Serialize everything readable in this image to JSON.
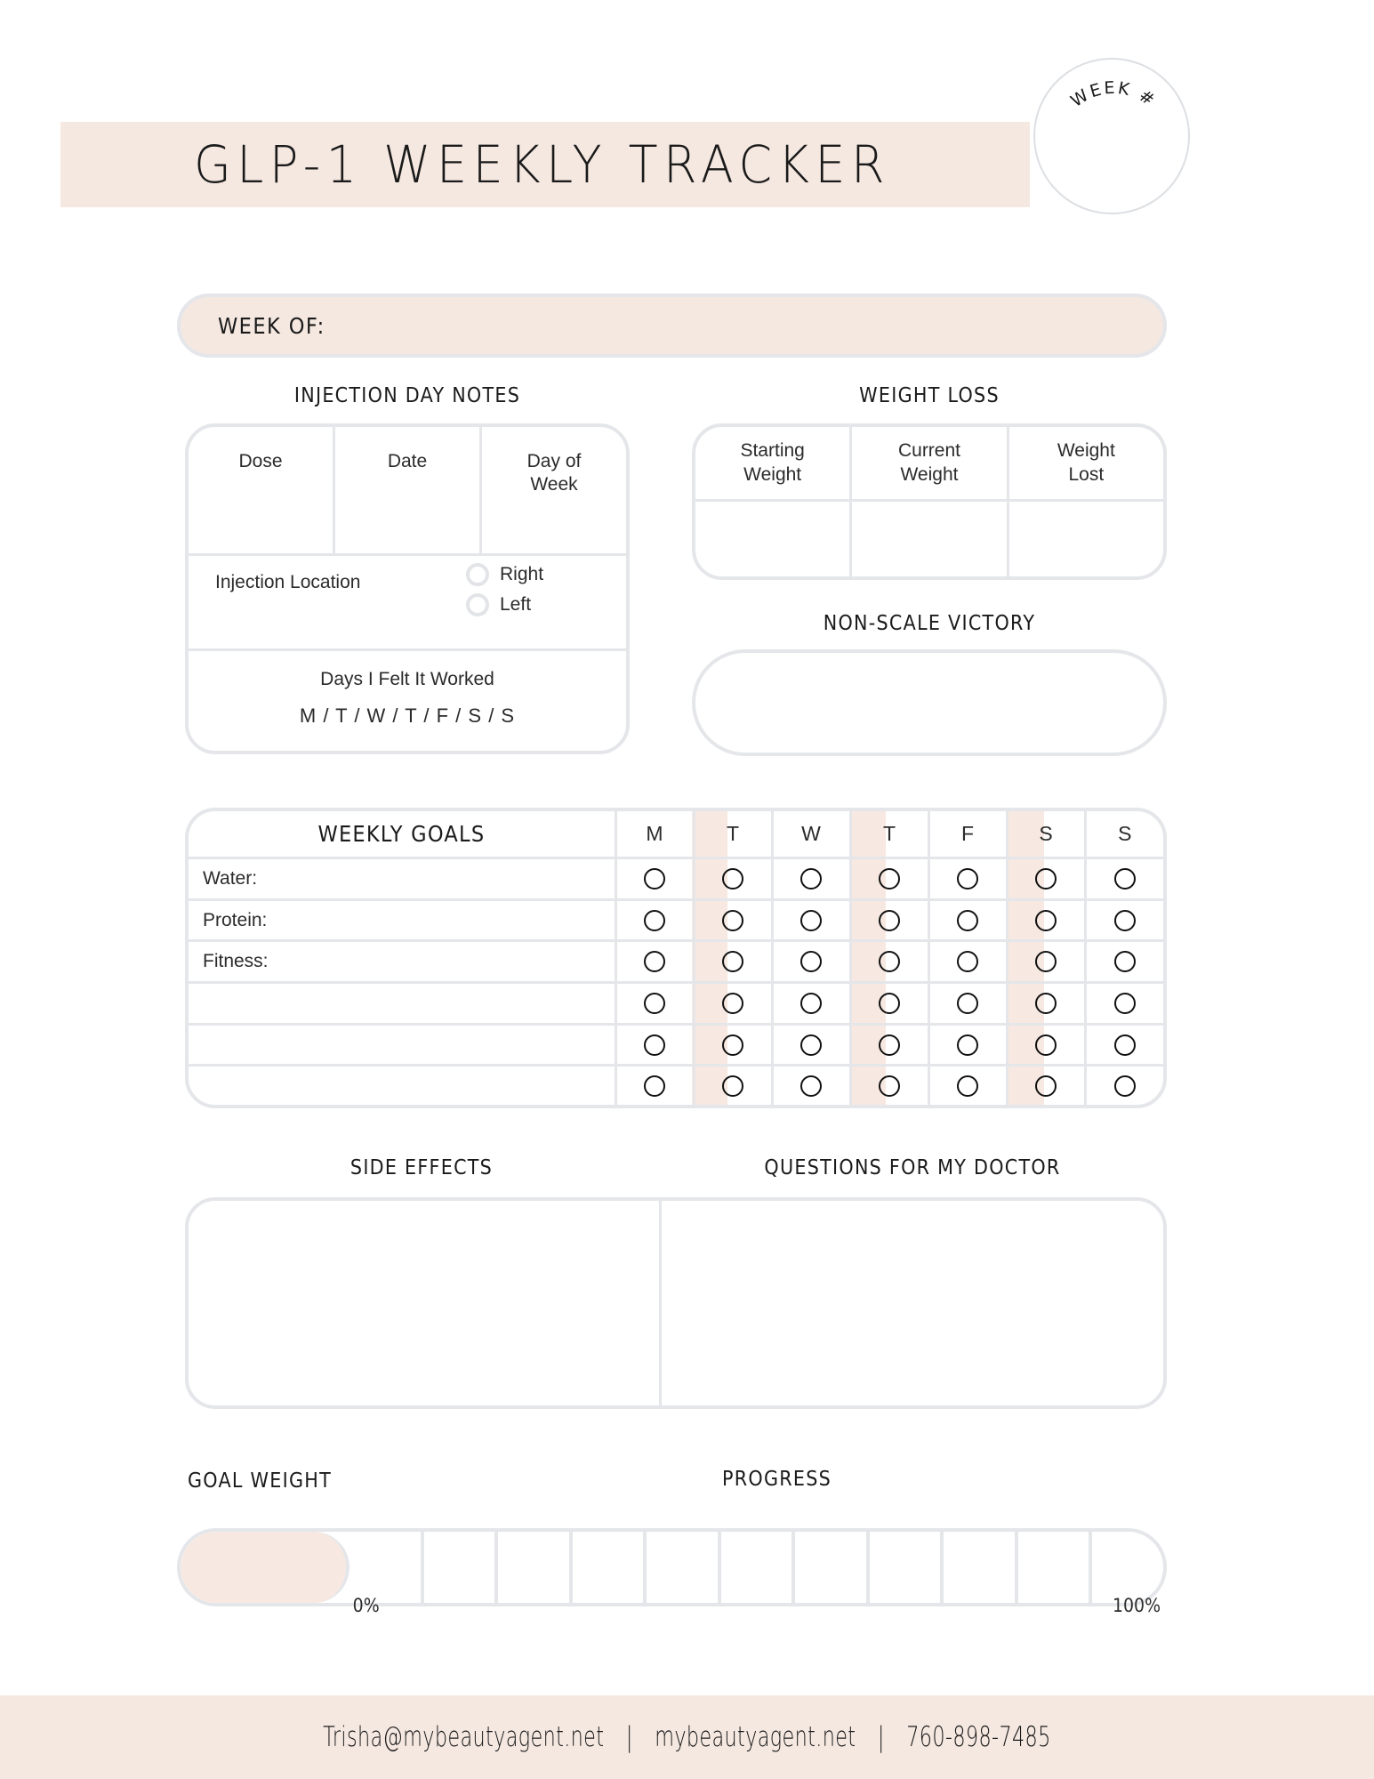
{
  "header": {
    "title": "GLP-1 WEEKLY TRACKER",
    "week_badge_label": "WEEK #"
  },
  "week_of": {
    "label": "WEEK OF:"
  },
  "injection": {
    "heading": "INJECTION DAY NOTES",
    "columns": [
      "Dose",
      "Date",
      "Day of\nWeek"
    ],
    "location_label": "Injection Location",
    "location_options": [
      "Right",
      "Left"
    ],
    "worked_label": "Days I Felt It Worked",
    "worked_days": "M / T / W / T / F / S / S"
  },
  "weight_loss": {
    "heading": "WEIGHT LOSS",
    "columns": [
      "Starting\nWeight",
      "Current\nWeight",
      "Weight\nLost"
    ],
    "values": [
      "",
      "",
      ""
    ]
  },
  "non_scale_victory": {
    "heading": "NON-SCALE VICTORY",
    "value": ""
  },
  "weekly_goals": {
    "heading": "WEEKLY GOALS",
    "days": [
      "M",
      "T",
      "W",
      "T",
      "F",
      "S",
      "S"
    ],
    "highlighted_day_indices": [
      1,
      3,
      5
    ],
    "rows": [
      "Water:",
      "Protein:",
      "Fitness:",
      "",
      "",
      ""
    ],
    "checkbox_icon": "circle-checkbox"
  },
  "side_effects": {
    "heading": "SIDE EFFECTS",
    "value": ""
  },
  "questions": {
    "heading": "QUESTIONS FOR MY DOCTOR",
    "value": ""
  },
  "progress": {
    "goal_weight_label": "GOAL WEIGHT",
    "progress_label": "PROGRESS",
    "min_label": "0%",
    "max_label": "100%",
    "segments": 11,
    "filled_segments": 1
  },
  "footer": {
    "email": "Trisha@mybeautyagent.net",
    "website": "mybeautyagent.net",
    "phone": "760-898-7485",
    "separator": "|"
  },
  "colors": {
    "accent_pink": "#f5e8e1",
    "stripe_pink": "#f7e9e1",
    "border_gray": "#e4e6ea",
    "text": "#1a1a1a"
  }
}
